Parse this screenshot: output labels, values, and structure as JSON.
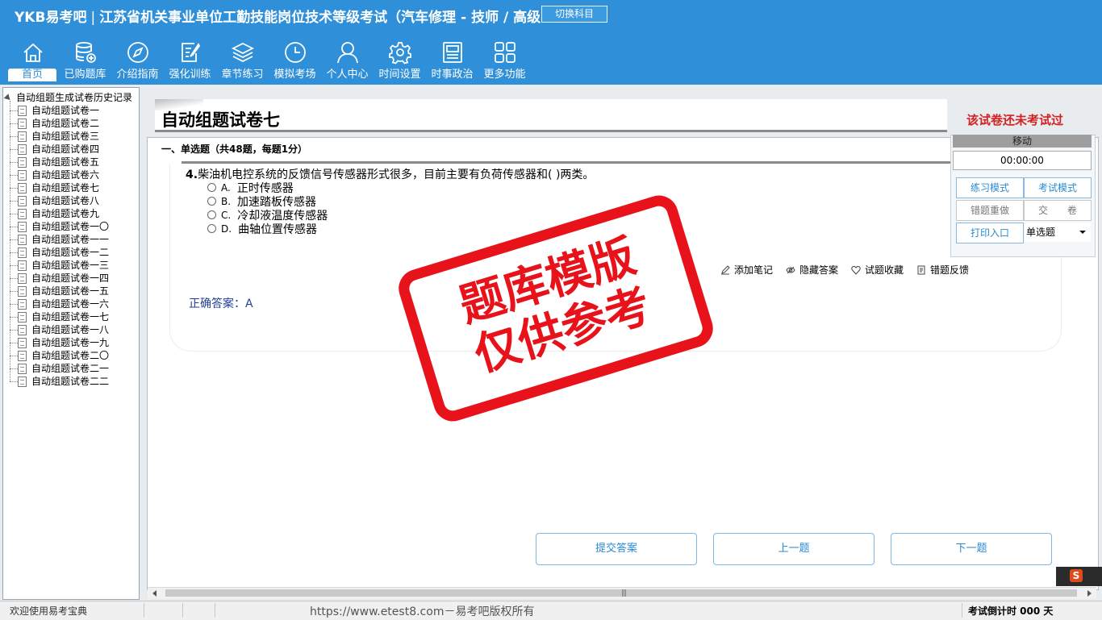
{
  "header": {
    "brand": "YKB易考吧",
    "exam_name": "江苏省机关事业单位工勤技能岗位技术等级考试（汽车修理 - 技师 / 高级",
    "switch_label": "切换科目"
  },
  "nav": [
    {
      "label": "首页",
      "icon": "home-icon"
    },
    {
      "label": "已购题库",
      "icon": "database-icon"
    },
    {
      "label": "介绍指南",
      "icon": "compass-icon"
    },
    {
      "label": "强化训练",
      "icon": "edit-icon"
    },
    {
      "label": "章节练习",
      "icon": "layers-icon"
    },
    {
      "label": "模拟考场",
      "icon": "clock-icon"
    },
    {
      "label": "个人中心",
      "icon": "user-icon"
    },
    {
      "label": "时间设置",
      "icon": "gear-icon"
    },
    {
      "label": "时事政治",
      "icon": "news-icon"
    },
    {
      "label": "更多功能",
      "icon": "grid-icon"
    }
  ],
  "tree": {
    "root": "自动组题生成试卷历史记录",
    "items": [
      "自动组题试卷一",
      "自动组题试卷二",
      "自动组题试卷三",
      "自动组题试卷四",
      "自动组题试卷五",
      "自动组题试卷六",
      "自动组题试卷七",
      "自动组题试卷八",
      "自动组题试卷九",
      "自动组题试卷一〇",
      "自动组题试卷一一",
      "自动组题试卷一二",
      "自动组题试卷一三",
      "自动组题试卷一四",
      "自动组题试卷一五",
      "自动组题试卷一六",
      "自动组题试卷一七",
      "自动组题试卷一八",
      "自动组题试卷一九",
      "自动组题试卷二〇",
      "自动组题试卷二一",
      "自动组题试卷二二"
    ]
  },
  "exam": {
    "title": "自动组题试卷七",
    "status": "该试卷还未考试过",
    "section": "一、单选题（共48题，每题1分）",
    "question_no": "4.",
    "question_text": "柴油机电控系统的反馈信号传感器形式很多，目前主要有负荷传感器和( )两类。",
    "options": [
      {
        "letter": "A.",
        "text": "正时传感器"
      },
      {
        "letter": "B.",
        "text": "加速踏板传感器"
      },
      {
        "letter": "C.",
        "text": "冷却液温度传感器"
      },
      {
        "letter": "D.",
        "text": "曲轴位置传感器"
      }
    ],
    "answer_label": "正确答案：",
    "answer": "A"
  },
  "tools": {
    "note": "添加笔记",
    "hide": "隐藏答案",
    "fav": "试题收藏",
    "report": "错题反馈"
  },
  "stamp": {
    "line1": "题库模版",
    "line2": "仅供参考"
  },
  "buttons": {
    "submit": "提交答案",
    "prev": "上一题",
    "next": "下一题"
  },
  "panel": {
    "move": "移动",
    "timer": "00:00:00",
    "practice": "练习模式",
    "exam": "考试模式",
    "redo": "错题重做",
    "hand_in": "交　　卷",
    "print": "打印入口",
    "type": "单选题"
  },
  "status": {
    "welcome": "欢迎使用易考宝典",
    "copyright": "https://www.etest8.com－易考吧版权所有",
    "countdown": "考试倒计时 000 天"
  },
  "colors": {
    "header": "#2f8fd8",
    "stamp": "#e8121b",
    "status_red": "#d32020"
  }
}
